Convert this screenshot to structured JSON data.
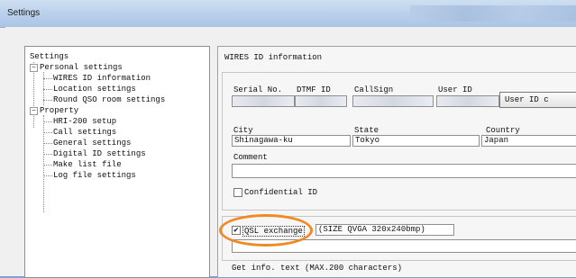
{
  "window": {
    "title": "Settings"
  },
  "tree": {
    "root": "Settings",
    "groups": [
      {
        "label": "Personal settings",
        "expander": "−",
        "items": [
          "WIRES ID information",
          "Location settings",
          "Round QSO room settings"
        ]
      },
      {
        "label": "Property",
        "expander": "−",
        "items": [
          "HRI-200 setup",
          "Call settings",
          "General settings",
          "Digital ID settings",
          "Make list file",
          "Log file settings"
        ]
      }
    ]
  },
  "panel": {
    "heading": "WIRES ID information",
    "columns": {
      "serial": "Serial No.",
      "dtmf": "DTMF ID",
      "callsign": "CallSign",
      "user_id": "User ID"
    },
    "user_id_button": "User ID c",
    "location": {
      "city_label": "City",
      "city_value": "Shinagawa-ku",
      "state_label": "State",
      "state_value": "Tokyo",
      "country_label": "Country",
      "country_value": "Japan"
    },
    "comment_label": "Comment",
    "confidential_label": "Confidential ID",
    "qsl": {
      "label": "QSL exchange",
      "checked": true,
      "check_mark": "✔",
      "size_text": "(SIZE QVGA 320x240bmp)"
    },
    "get_info_label": "Get info. text (MAX.200 characters)"
  },
  "colors": {
    "highlight_oval": "#f08a24",
    "titlebar": "#bcd2ec"
  }
}
